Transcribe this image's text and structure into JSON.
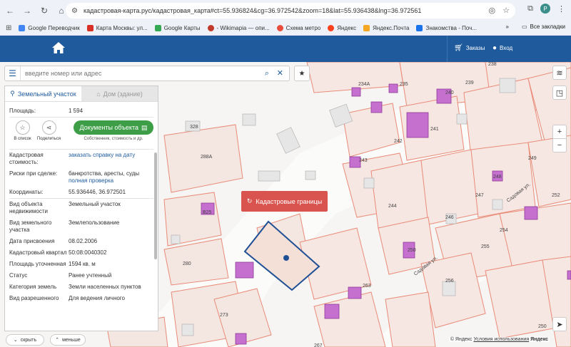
{
  "browser": {
    "url": "кадастровая-карта.рус/кадастровая_карта#ct=55.936824&cg=36.972542&zoom=18&lat=55.936438&lng=36.972561",
    "avatar_letter": "P",
    "bookmarks": [
      {
        "label": "Google Переводчик",
        "color": "#4285f4"
      },
      {
        "label": "Карта Москвы: ул...",
        "color": "#d93025"
      },
      {
        "label": "Google Карты",
        "color": "#34a853"
      },
      {
        "label": "- Wikimapia — опи...",
        "color": "#c0392b"
      },
      {
        "label": "Схема метро",
        "color": "#e74c3c"
      },
      {
        "label": "Яндекс",
        "color": "#fc3f1d"
      },
      {
        "label": "Яндекс.Почта",
        "color": "#f5a623"
      },
      {
        "label": "Знакомства - Поч...",
        "color": "#1a73e8"
      }
    ],
    "all_bookmarks": "Все закладки"
  },
  "header": {
    "orders": "Заказы",
    "login": "Вход"
  },
  "search": {
    "placeholder": "введите номер или адрес"
  },
  "panel": {
    "tab_land": "Земельный участок",
    "tab_house": "Дом (здание)",
    "area_label": "Площадь:",
    "area_value": "1 594",
    "action_list": "В список",
    "action_share": "Поделиться",
    "docs_button": "Документы объекта",
    "docs_sub": "Собственник, стоимость и др.",
    "rows": {
      "cad_cost_label": "Кадастровая стоимость:",
      "cad_cost_link": "заказать справку на дату",
      "risks_label": "Риски при сделке:",
      "risks_value": "банкротства, аресты, суды",
      "risks_link": "полная проверка",
      "coords_label": "Координаты:",
      "coords_value": "55.936446, 36.972501",
      "type_label": "Вид объекта недвижимости",
      "type_value": "Земельный участок",
      "kind_label": "Вид земельного участка",
      "kind_value": "Землепользование",
      "date_label": "Дата присвоения",
      "date_value": "08.02.2006",
      "quarter_label": "Кадастровый квартал",
      "quarter_value": "50:08:0040302",
      "precise_area_label": "Площадь уточненная",
      "precise_area_value": "1594 кв. м",
      "status_label": "Статус",
      "status_value": "Ранее учтенный",
      "category_label": "Категория земель",
      "category_value": "Земли населенных пунктов",
      "use_label": "Вид разрешенного",
      "use_value": "Для ведения личного"
    }
  },
  "map": {
    "kad_button": "Кадастровые границы",
    "hide": "скрыть",
    "less": "меньше",
    "attribution": "© Яндекс",
    "terms": "Условия использования",
    "brand": "Яндекс",
    "street": "Садовая ул.",
    "labels": [
      "238",
      "239",
      "234А",
      "235",
      "240",
      "328",
      "241",
      "242",
      "288А",
      "243",
      "249",
      "248",
      "247",
      "252",
      "244",
      "246",
      "254",
      "255",
      "280",
      "256",
      "263",
      "273",
      "267",
      "250",
      "В25",
      "250"
    ]
  },
  "colors": {
    "header": "#1f5b9c",
    "parcel": "#e98b78",
    "building": "#c56fcf",
    "selected": "#1f4f94",
    "kad_button": "#d9534f",
    "docs_button": "#3e9e48"
  }
}
